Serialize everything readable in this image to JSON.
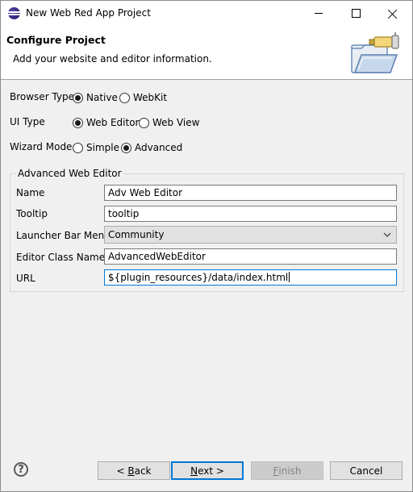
{
  "window": {
    "title": "New Web Red App Project"
  },
  "header": {
    "title": "Configure Project",
    "description": "Add your website and editor information."
  },
  "browser_type": {
    "label": "Browser Type",
    "options": [
      "Native",
      "WebKit"
    ],
    "selected": "Native"
  },
  "ui_type": {
    "label": "UI Type",
    "options": [
      "Web Editor",
      "Web View"
    ],
    "selected": "Web Editor"
  },
  "wizard_mode": {
    "label": "Wizard Mode",
    "options": [
      "Simple",
      "Advanced"
    ],
    "selected": "Advanced"
  },
  "group": {
    "title": "Advanced Web Editor",
    "name": {
      "label": "Name",
      "value": "Adv Web Editor"
    },
    "tooltip": {
      "label": "Tooltip",
      "value": "tooltip"
    },
    "launcher": {
      "label": "Launcher Bar Menu",
      "value": "Community"
    },
    "editor_class": {
      "label": "Editor Class Name",
      "value": "AdvancedWebEditor"
    },
    "url": {
      "label": "URL",
      "value": "${plugin_resources}/data/index.html"
    }
  },
  "footer": {
    "help_icon": "help-icon",
    "buttons": {
      "back": {
        "accel": "B",
        "rest": "ack",
        "prefix": "< "
      },
      "next": {
        "accel": "N",
        "rest": "ext >"
      },
      "finish": {
        "accel": "F",
        "rest": "inish"
      },
      "cancel": "Cancel"
    }
  },
  "colors": {
    "focus": "#0078d7",
    "header_bg": "#ffffff",
    "dialog_bg": "#f0f0f0"
  }
}
